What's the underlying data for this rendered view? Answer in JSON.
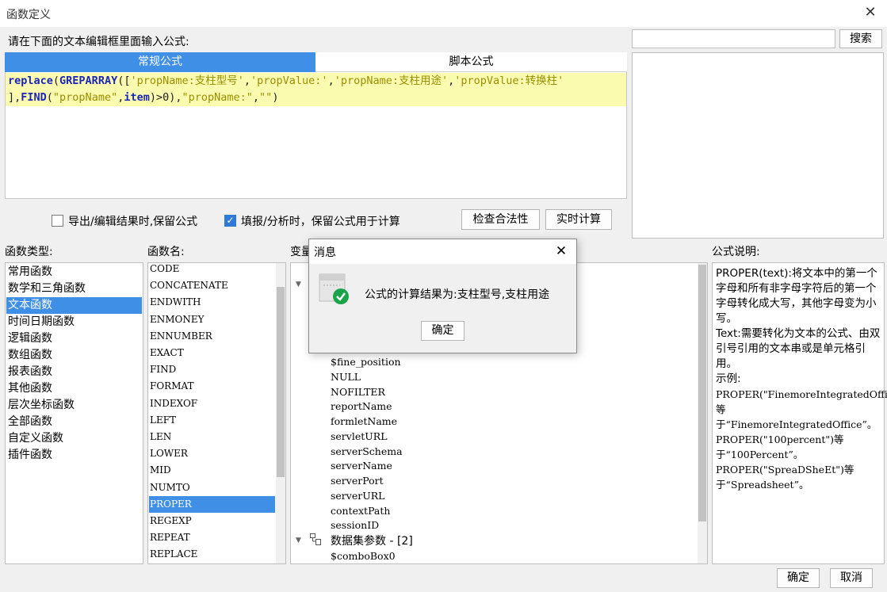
{
  "window": {
    "title": "函数定义",
    "close_glyph": "✕"
  },
  "prompt_label": "请在下面的文本编辑框里面输入公式:",
  "search": {
    "placeholder": "",
    "button_label": "搜索"
  },
  "tabs": [
    {
      "label": "常规公式",
      "active": true
    },
    {
      "label": "脚本公式",
      "active": false
    }
  ],
  "formula": {
    "line1": [
      {
        "t": "fn",
        "v": "replace"
      },
      {
        "t": "op",
        "v": "("
      },
      {
        "t": "fn",
        "v": "GREPARRAY"
      },
      {
        "t": "op",
        "v": "(["
      },
      {
        "t": "str",
        "v": "'propName:支柱型号'"
      },
      {
        "t": "op",
        "v": ","
      },
      {
        "t": "str",
        "v": "'propValue:'"
      },
      {
        "t": "op",
        "v": ","
      },
      {
        "t": "str",
        "v": "'propName:支柱用途'"
      },
      {
        "t": "op",
        "v": ","
      },
      {
        "t": "str",
        "v": "'propValue:转换柱'"
      }
    ],
    "line2": [
      {
        "t": "op",
        "v": "],"
      },
      {
        "t": "fn",
        "v": "FIND"
      },
      {
        "t": "op",
        "v": "("
      },
      {
        "t": "str",
        "v": "\"propName\""
      },
      {
        "t": "op",
        "v": ","
      },
      {
        "t": "fn",
        "v": "item"
      },
      {
        "t": "op",
        "v": ")>0),"
      },
      {
        "t": "str",
        "v": "\"propName:\""
      },
      {
        "t": "op",
        "v": ","
      },
      {
        "t": "str",
        "v": "\"\""
      },
      {
        "t": "op",
        "v": ")"
      }
    ]
  },
  "options": {
    "keep_formula_export": {
      "label": "导出/编辑结果时,保留公式",
      "checked": false
    },
    "keep_formula_fill": {
      "label": "填报/分析时，保留公式用于计算",
      "checked": true
    },
    "check_button": "检查合法性",
    "realtime_button": "实时计算"
  },
  "function_types": {
    "header": "函数类型:",
    "items": [
      "常用函数",
      "数学和三角函数",
      "文本函数",
      "时间日期函数",
      "逻辑函数",
      "数组函数",
      "报表函数",
      "其他函数",
      "层次坐标函数",
      "全部函数",
      "自定义函数",
      "插件函数"
    ],
    "selected_index": 2
  },
  "function_names": {
    "header": "函数名:",
    "items": [
      "CODE",
      "CONCATENATE",
      "ENDWITH",
      "ENMONEY",
      "ENNUMBER",
      "EXACT",
      "FIND",
      "FORMAT",
      "INDEXOF",
      "LEFT",
      "LEN",
      "LOWER",
      "MID",
      "NUMTO",
      "PROPER",
      "REGEXP",
      "REPEAT",
      "REPLACE"
    ],
    "selected_index": 14
  },
  "variables": {
    "header": "变量",
    "items": [
      "$fine_position",
      "NULL",
      "NOFILTER",
      "reportName",
      "formletName",
      "servletURL",
      "serverSchema",
      "serverName",
      "serverPort",
      "serverURL",
      "contextPath",
      "sessionID"
    ],
    "group_label": "数据集参数 - [2]",
    "group_child": "$comboBox0"
  },
  "description": {
    "header": "公式说明:",
    "lines": [
      "PROPER(text):将文本中的第一个字母和所有非字母字符后的第一个字母转化成大写，其他字母变为小写。",
      "Text:需要转化为文本的公式、由双引号引用的文本串或是单元格引用。",
      "示例:",
      "PROPER(\"FinemoreIntegratedOffice\")等于“FinemoreIntegratedOffice”。",
      "PROPER(\"100percent\")等于“100Percent”。",
      "PROPER(\"SpreaDSheEt\")等于“Spreadsheet”。"
    ]
  },
  "footer": {
    "ok": "确定",
    "cancel": "取消"
  },
  "message_dialog": {
    "title": "消息",
    "close_glyph": "✕",
    "text": "公式的计算结果为:支柱型号,支柱用途",
    "ok": "确定",
    "icon": "success-check-icon",
    "icon_color": "#1aa34a"
  },
  "colors": {
    "accent": "#3f8fe6",
    "editor_highlight": "#fbfbb0"
  }
}
